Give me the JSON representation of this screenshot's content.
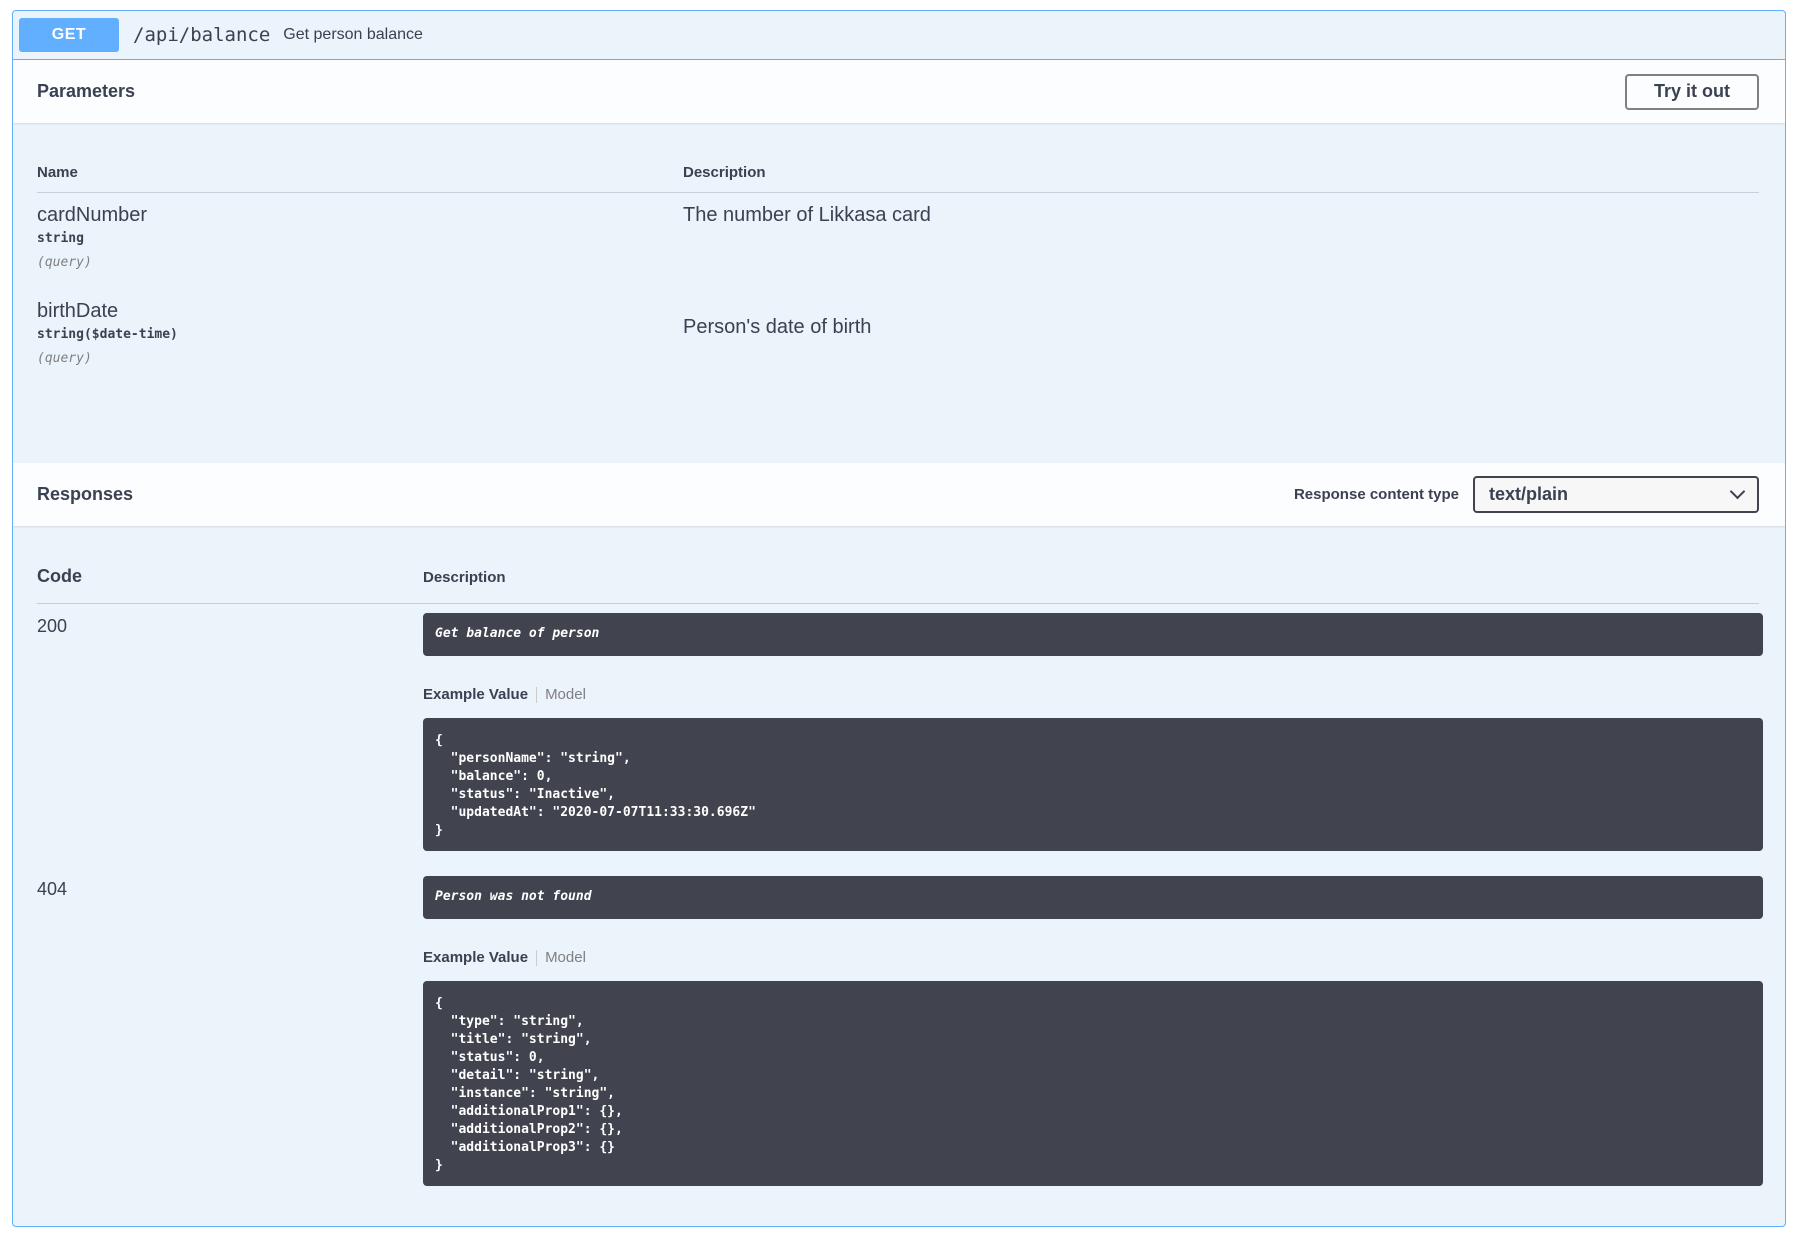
{
  "operation": {
    "method": "GET",
    "path": "/api/balance",
    "summary": "Get person balance"
  },
  "parameters": {
    "title": "Parameters",
    "try_button": "Try it out",
    "columns": {
      "name": "Name",
      "description": "Description"
    },
    "rows": [
      {
        "name": "cardNumber",
        "type": "string",
        "in": "(query)",
        "description": "The number of Likkasa card"
      },
      {
        "name": "birthDate",
        "type": "string($date-time)",
        "in": "(query)",
        "description": "Person's date of birth"
      }
    ]
  },
  "responses": {
    "title": "Responses",
    "content_type_label": "Response content type",
    "content_type_value": "text/plain",
    "columns": {
      "code": "Code",
      "description": "Description"
    },
    "rows": [
      {
        "code": "200",
        "description": "Get balance of person",
        "tab_example": "Example Value",
        "tab_model": "Model",
        "example": "{\n  \"personName\": \"string\",\n  \"balance\": 0,\n  \"status\": \"Inactive\",\n  \"updatedAt\": \"2020-07-07T11:33:30.696Z\"\n}"
      },
      {
        "code": "404",
        "description": "Person was not found",
        "tab_example": "Example Value",
        "tab_model": "Model",
        "example": "{\n  \"type\": \"string\",\n  \"title\": \"string\",\n  \"status\": 0,\n  \"detail\": \"string\",\n  \"instance\": \"string\",\n  \"additionalProp1\": {},\n  \"additionalProp2\": {},\n  \"additionalProp3\": {}\n}"
      }
    ]
  },
  "colors": {
    "get_accent": "#61affe",
    "block_background": "#ebf3fb",
    "code_background": "#41444e"
  }
}
